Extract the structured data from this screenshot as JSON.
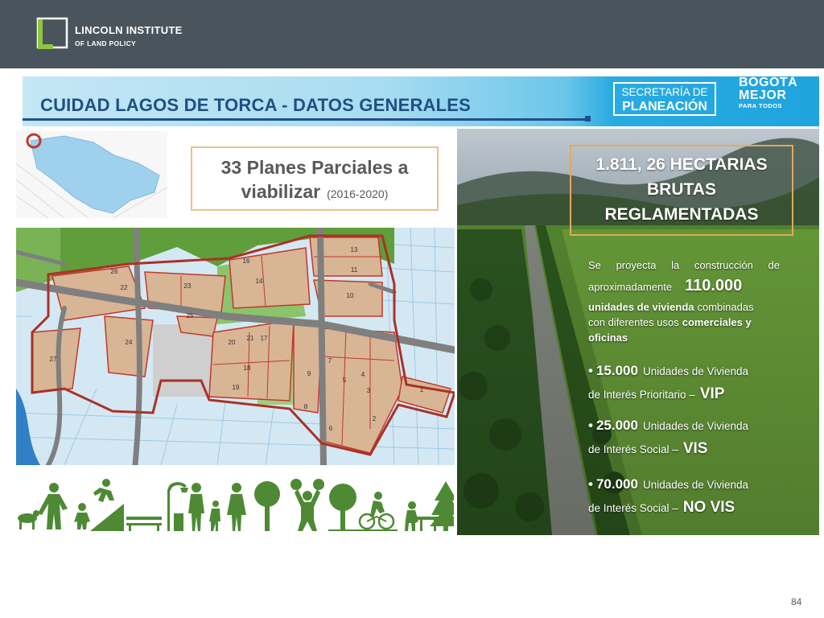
{
  "header": {
    "logo_line1": "LINCOLN INSTITUTE",
    "logo_line2": "OF LAND POLICY"
  },
  "slide": {
    "title": "CUIDAD LAGOS DE TORCA - DATOS GENERALES",
    "logos": {
      "secretaria_line1": "SECRETARÍA DE",
      "secretaria_line2": "PLANEACIÓN",
      "bogota_line1": "BOGOTÁ",
      "bogota_line2": "MEJOR",
      "bogota_line3": "PARA TODOS"
    },
    "plans_box": {
      "line1": "33 Planes Parciales a",
      "line2": "viabilizar",
      "years": "(2016-2020)"
    },
    "map": {
      "parcel_labels": [
        "1",
        "2",
        "3",
        "4",
        "5",
        "6",
        "7",
        "8",
        "9",
        "10",
        "11",
        "13",
        "14",
        "16",
        "17",
        "18",
        "19",
        "20",
        "21",
        "22",
        "23",
        "24",
        "25",
        "26",
        "27"
      ]
    },
    "hectares_box": {
      "line1": "1.811, 26 HECTARIAS",
      "line2": "BRUTAS",
      "line3": "REGLAMENTADAS"
    },
    "summary": {
      "line1": "Se proyecta la construcción de",
      "line2_text": "aproximadamente",
      "line2_number": "110.000",
      "line3_bold": "unidades de vivienda",
      "line3_text": "combinadas",
      "line4_text": "con diferentes usos",
      "line4_bold": "comerciales y",
      "line5_bold": "oficinas"
    },
    "housing": [
      {
        "bullet": "•",
        "count": "15.000",
        "label": "Unidades de Vivienda",
        "prefix": "de Interés Prioritario –",
        "category": "VIP"
      },
      {
        "bullet": "•",
        "count": "25.000",
        "label": "Unidades de Vivienda",
        "prefix": "de Interés Social –",
        "category": "VIS"
      },
      {
        "bullet": "•",
        "count": "70.000",
        "label": "Unidades de Vivienda",
        "prefix": "de Interés Social –",
        "category": "NO VIS"
      }
    ],
    "colors": {
      "header": "#4a545c",
      "title_text": "#1f4f82",
      "icon_green": "#4e8a34",
      "parcel_outline": "#c0392b"
    }
  },
  "page_number": "84"
}
